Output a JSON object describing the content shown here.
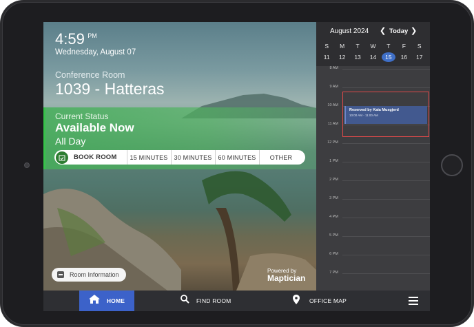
{
  "clock": {
    "time": "4:59",
    "ampm": "PM",
    "date": "Wednesday, August 07"
  },
  "room": {
    "label": "Conference Room",
    "name": "1039 - Hatteras"
  },
  "status": {
    "label": "Current Status",
    "value": "Available Now",
    "sub": "All Day",
    "color": "#37c24a"
  },
  "booking": {
    "book_label": "BOOK ROOM",
    "options": [
      "15 MINUTES",
      "30 MINUTES",
      "60 MINUTES",
      "OTHER"
    ]
  },
  "room_info": {
    "label": "Room Information"
  },
  "powered": {
    "by": "Powered by",
    "logo": "Maptician"
  },
  "calendar": {
    "month": "August",
    "year": "2024",
    "today_label": "Today",
    "weekdays": [
      "S",
      "M",
      "T",
      "W",
      "T",
      "F",
      "S"
    ],
    "dates": [
      "11",
      "12",
      "13",
      "14",
      "15",
      "16",
      "17"
    ],
    "selected_date": "15",
    "hours": [
      "8 AM",
      "9 AM",
      "10 AM",
      "11 AM",
      "12 PM",
      "1 PM",
      "2 PM",
      "3 PM",
      "4 PM",
      "5 PM",
      "6 PM",
      "7 PM"
    ],
    "event": {
      "title": "Reserved by Kaia Musgjerd",
      "time": "10:00 AM - 11:00 AM"
    },
    "accent": "#3f6fc7"
  },
  "nav": {
    "home": "HOME",
    "find_room": "FIND ROOM",
    "office_map": "OFFICE MAP",
    "accent": "#3c62c9"
  },
  "icons": {
    "home": "home-icon",
    "search": "search-icon",
    "map_pin": "map-pin-icon",
    "menu": "menu-icon",
    "calendar_check": "calendar-check-icon"
  }
}
